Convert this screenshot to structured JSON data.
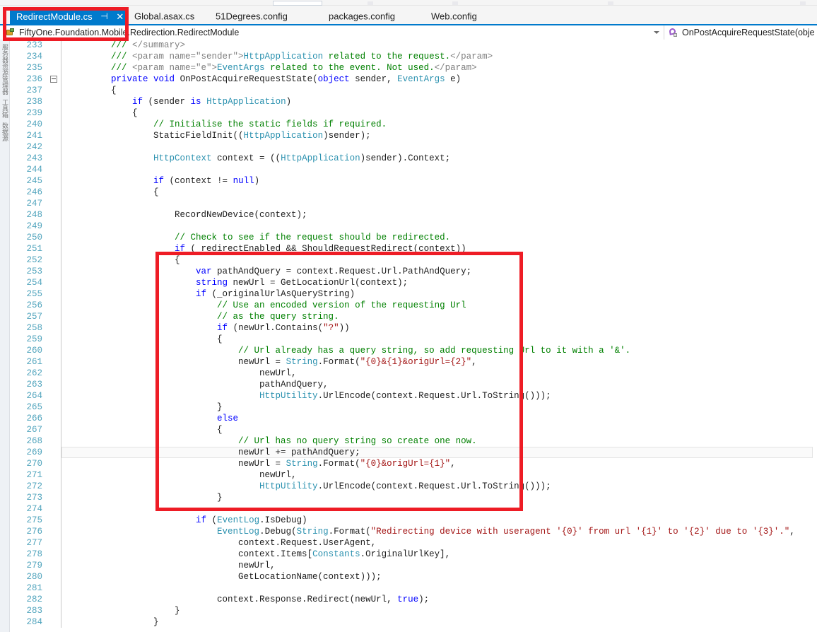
{
  "window": {
    "app": "visual-studio-code-editor"
  },
  "toolbar": {
    "search_box_placeholder": ""
  },
  "tabs": [
    {
      "label": "RedirectModule.cs",
      "active": true,
      "pin_icon": "pin-icon",
      "close_icon": "close-icon"
    },
    {
      "label": "Global.asax.cs",
      "active": false
    },
    {
      "label": "51Degrees.config",
      "active": false
    },
    {
      "label": "packages.config",
      "active": false
    },
    {
      "label": "Web.config",
      "active": false
    }
  ],
  "navbar": {
    "class_icon": "class-icon",
    "class_value": "FiftyOne.Foundation.Mobile.Redirection.RedirectModule",
    "member_icon": "method-icon",
    "member_value": "OnPostAcquireRequestState(obje",
    "dropdown_icon": "chevron-down-icon"
  },
  "left_dock": {
    "items": [
      {
        "label": "服务器资源管理器"
      },
      {
        "label": "工具箱"
      },
      {
        "label": "数据源"
      }
    ]
  },
  "annotations": {
    "tab_highlight": {
      "color": "#ee1c25",
      "target": "RedirectModule.cs"
    },
    "code_highlight": {
      "color": "#ee1c25",
      "target": "url-redirect-block"
    }
  },
  "editor": {
    "first_line": 233,
    "current_line": 269,
    "fold_line": 236,
    "lines": [
      {
        "n": 233,
        "tokens": [
          {
            "t": "c",
            "v": "        /// "
          },
          {
            "t": "x",
            "v": "</summary>"
          }
        ]
      },
      {
        "n": 234,
        "tokens": [
          {
            "t": "c",
            "v": "        /// "
          },
          {
            "t": "x",
            "v": "<param name=\"sender\">"
          },
          {
            "t": "t",
            "v": "HttpApplication"
          },
          {
            "t": "c",
            "v": " related to the request."
          },
          {
            "t": "x",
            "v": "</param>"
          }
        ]
      },
      {
        "n": 235,
        "tokens": [
          {
            "t": "c",
            "v": "        /// "
          },
          {
            "t": "x",
            "v": "<param name=\"e\">"
          },
          {
            "t": "t",
            "v": "EventArgs"
          },
          {
            "t": "c",
            "v": " related to the event. Not used."
          },
          {
            "t": "x",
            "v": "</param>"
          }
        ]
      },
      {
        "n": 236,
        "fold": true,
        "tokens": [
          {
            "t": "p",
            "v": "        "
          },
          {
            "t": "k",
            "v": "private"
          },
          {
            "t": "p",
            "v": " "
          },
          {
            "t": "k",
            "v": "void"
          },
          {
            "t": "p",
            "v": " OnPostAcquireRequestState("
          },
          {
            "t": "k",
            "v": "object"
          },
          {
            "t": "p",
            "v": " sender, "
          },
          {
            "t": "t",
            "v": "EventArgs"
          },
          {
            "t": "p",
            "v": " e)"
          }
        ]
      },
      {
        "n": 237,
        "tokens": [
          {
            "t": "p",
            "v": "        {"
          }
        ]
      },
      {
        "n": 238,
        "tokens": [
          {
            "t": "p",
            "v": "            "
          },
          {
            "t": "k",
            "v": "if"
          },
          {
            "t": "p",
            "v": " (sender "
          },
          {
            "t": "k",
            "v": "is"
          },
          {
            "t": "p",
            "v": " "
          },
          {
            "t": "t",
            "v": "HttpApplication"
          },
          {
            "t": "p",
            "v": ")"
          }
        ]
      },
      {
        "n": 239,
        "tokens": [
          {
            "t": "p",
            "v": "            {"
          }
        ]
      },
      {
        "n": 240,
        "tokens": [
          {
            "t": "c",
            "v": "                // Initialise the static fields if required."
          }
        ]
      },
      {
        "n": 241,
        "tokens": [
          {
            "t": "p",
            "v": "                StaticFieldInit(("
          },
          {
            "t": "t",
            "v": "HttpApplication"
          },
          {
            "t": "p",
            "v": ")sender);"
          }
        ]
      },
      {
        "n": 242,
        "tokens": [
          {
            "t": "p",
            "v": ""
          }
        ]
      },
      {
        "n": 243,
        "tokens": [
          {
            "t": "p",
            "v": "                "
          },
          {
            "t": "t",
            "v": "HttpContext"
          },
          {
            "t": "p",
            "v": " context = (("
          },
          {
            "t": "t",
            "v": "HttpApplication"
          },
          {
            "t": "p",
            "v": ")sender).Context;"
          }
        ]
      },
      {
        "n": 244,
        "tokens": [
          {
            "t": "p",
            "v": ""
          }
        ]
      },
      {
        "n": 245,
        "tokens": [
          {
            "t": "p",
            "v": "                "
          },
          {
            "t": "k",
            "v": "if"
          },
          {
            "t": "p",
            "v": " (context != "
          },
          {
            "t": "k",
            "v": "null"
          },
          {
            "t": "p",
            "v": ")"
          }
        ]
      },
      {
        "n": 246,
        "tokens": [
          {
            "t": "p",
            "v": "                {"
          }
        ]
      },
      {
        "n": 247,
        "tokens": [
          {
            "t": "p",
            "v": ""
          }
        ]
      },
      {
        "n": 248,
        "tokens": [
          {
            "t": "p",
            "v": "                    RecordNewDevice(context);"
          }
        ]
      },
      {
        "n": 249,
        "tokens": [
          {
            "t": "p",
            "v": ""
          }
        ]
      },
      {
        "n": 250,
        "tokens": [
          {
            "t": "c",
            "v": "                    // Check to see if the request should be redirected."
          }
        ]
      },
      {
        "n": 251,
        "tokens": [
          {
            "t": "p",
            "v": "                    "
          },
          {
            "t": "k",
            "v": "if"
          },
          {
            "t": "p",
            "v": " (_redirectEnabled && ShouldRequestRedirect(context))"
          }
        ]
      },
      {
        "n": 252,
        "tokens": [
          {
            "t": "p",
            "v": "                    {"
          }
        ]
      },
      {
        "n": 253,
        "tokens": [
          {
            "t": "p",
            "v": "                        "
          },
          {
            "t": "k",
            "v": "var"
          },
          {
            "t": "p",
            "v": " pathAndQuery = context.Request.Url.PathAndQuery;"
          }
        ]
      },
      {
        "n": 254,
        "tokens": [
          {
            "t": "p",
            "v": "                        "
          },
          {
            "t": "k",
            "v": "string"
          },
          {
            "t": "p",
            "v": " newUrl = GetLocationUrl(context);"
          }
        ]
      },
      {
        "n": 255,
        "tokens": [
          {
            "t": "p",
            "v": "                        "
          },
          {
            "t": "k",
            "v": "if"
          },
          {
            "t": "p",
            "v": " (_originalUrlAsQueryString)"
          }
        ]
      },
      {
        "n": 256,
        "tokens": [
          {
            "t": "c",
            "v": "                            // Use an encoded version of the requesting Url"
          }
        ]
      },
      {
        "n": 257,
        "tokens": [
          {
            "t": "c",
            "v": "                            // as the query string."
          }
        ]
      },
      {
        "n": 258,
        "tokens": [
          {
            "t": "p",
            "v": "                            "
          },
          {
            "t": "k",
            "v": "if"
          },
          {
            "t": "p",
            "v": " (newUrl.Contains("
          },
          {
            "t": "s",
            "v": "\"?\""
          },
          {
            "t": "p",
            "v": "))"
          }
        ]
      },
      {
        "n": 259,
        "tokens": [
          {
            "t": "p",
            "v": "                            {"
          }
        ]
      },
      {
        "n": 260,
        "tokens": [
          {
            "t": "c",
            "v": "                                // Url already has a query string, so add requesting Url to it with a '&'."
          }
        ]
      },
      {
        "n": 261,
        "tokens": [
          {
            "t": "p",
            "v": "                                newUrl = "
          },
          {
            "t": "t",
            "v": "String"
          },
          {
            "t": "p",
            "v": ".Format("
          },
          {
            "t": "s",
            "v": "\"{0}&{1}&origUrl={2}\""
          },
          {
            "t": "p",
            "v": ","
          }
        ]
      },
      {
        "n": 262,
        "tokens": [
          {
            "t": "p",
            "v": "                                    newUrl,"
          }
        ]
      },
      {
        "n": 263,
        "tokens": [
          {
            "t": "p",
            "v": "                                    pathAndQuery,"
          }
        ]
      },
      {
        "n": 264,
        "tokens": [
          {
            "t": "p",
            "v": "                                    "
          },
          {
            "t": "t",
            "v": "HttpUtility"
          },
          {
            "t": "p",
            "v": ".UrlEncode(context.Request.Url.ToString()));"
          }
        ]
      },
      {
        "n": 265,
        "tokens": [
          {
            "t": "p",
            "v": "                            }"
          }
        ]
      },
      {
        "n": 266,
        "tokens": [
          {
            "t": "p",
            "v": "                            "
          },
          {
            "t": "k",
            "v": "else"
          }
        ]
      },
      {
        "n": 267,
        "tokens": [
          {
            "t": "p",
            "v": "                            {"
          }
        ]
      },
      {
        "n": 268,
        "tokens": [
          {
            "t": "c",
            "v": "                                // Url has no query string so create one now."
          }
        ]
      },
      {
        "n": 269,
        "current": true,
        "tokens": [
          {
            "t": "p",
            "v": "                                newUrl += pathAndQuery;"
          }
        ]
      },
      {
        "n": 270,
        "tokens": [
          {
            "t": "p",
            "v": "                                newUrl = "
          },
          {
            "t": "t",
            "v": "String"
          },
          {
            "t": "p",
            "v": ".Format("
          },
          {
            "t": "s",
            "v": "\"{0}&origUrl={1}\""
          },
          {
            "t": "p",
            "v": ","
          }
        ]
      },
      {
        "n": 271,
        "tokens": [
          {
            "t": "p",
            "v": "                                    newUrl,"
          }
        ]
      },
      {
        "n": 272,
        "tokens": [
          {
            "t": "p",
            "v": "                                    "
          },
          {
            "t": "t",
            "v": "HttpUtility"
          },
          {
            "t": "p",
            "v": ".UrlEncode(context.Request.Url.ToString()));"
          }
        ]
      },
      {
        "n": 273,
        "tokens": [
          {
            "t": "p",
            "v": "                            }"
          }
        ]
      },
      {
        "n": 274,
        "tokens": [
          {
            "t": "p",
            "v": ""
          }
        ]
      },
      {
        "n": 275,
        "tokens": [
          {
            "t": "p",
            "v": "                        "
          },
          {
            "t": "k",
            "v": "if"
          },
          {
            "t": "p",
            "v": " ("
          },
          {
            "t": "t",
            "v": "EventLog"
          },
          {
            "t": "p",
            "v": ".IsDebug)"
          }
        ]
      },
      {
        "n": 276,
        "tokens": [
          {
            "t": "p",
            "v": "                            "
          },
          {
            "t": "t",
            "v": "EventLog"
          },
          {
            "t": "p",
            "v": ".Debug("
          },
          {
            "t": "t",
            "v": "String"
          },
          {
            "t": "p",
            "v": ".Format("
          },
          {
            "t": "s",
            "v": "\"Redirecting device with useragent '{0}' from url '{1}' to '{2}' due to '{3}'.\""
          },
          {
            "t": "p",
            "v": ","
          }
        ]
      },
      {
        "n": 277,
        "tokens": [
          {
            "t": "p",
            "v": "                                context.Request.UserAgent,"
          }
        ]
      },
      {
        "n": 278,
        "tokens": [
          {
            "t": "p",
            "v": "                                context.Items["
          },
          {
            "t": "t",
            "v": "Constants"
          },
          {
            "t": "p",
            "v": ".OriginalUrlKey],"
          }
        ]
      },
      {
        "n": 279,
        "tokens": [
          {
            "t": "p",
            "v": "                                newUrl,"
          }
        ]
      },
      {
        "n": 280,
        "tokens": [
          {
            "t": "p",
            "v": "                                GetLocationName(context)));"
          }
        ]
      },
      {
        "n": 281,
        "tokens": [
          {
            "t": "p",
            "v": ""
          }
        ]
      },
      {
        "n": 282,
        "tokens": [
          {
            "t": "p",
            "v": "                            context.Response.Redirect(newUrl, "
          },
          {
            "t": "k",
            "v": "true"
          },
          {
            "t": "p",
            "v": ");"
          }
        ]
      },
      {
        "n": 283,
        "tokens": [
          {
            "t": "p",
            "v": "                    }"
          }
        ]
      },
      {
        "n": 284,
        "tokens": [
          {
            "t": "p",
            "v": "                }"
          }
        ]
      }
    ]
  }
}
